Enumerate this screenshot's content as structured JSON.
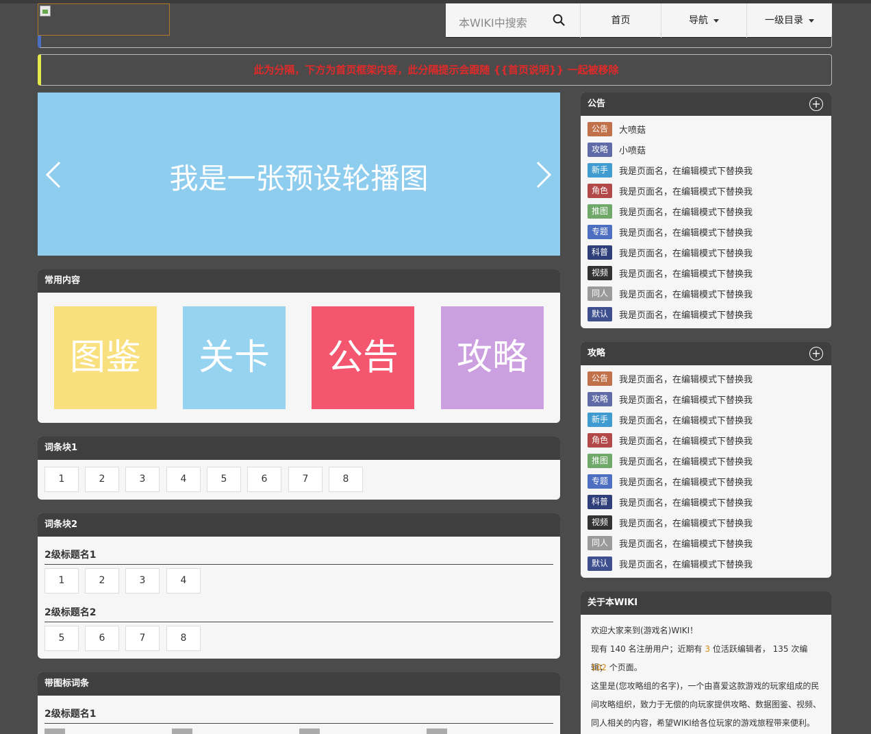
{
  "nav": {
    "search_text": "本WIKI中搜索",
    "home": "首页",
    "navigation": "导航",
    "level1": "一级目录"
  },
  "notice": "此为分隔，下方为首页框架内容，此分隔提示会跟随 {{首页说明}} 一起被移除",
  "carousel": {
    "text": "我是一张预设轮播图"
  },
  "common": {
    "title": "常用内容",
    "tiles": [
      {
        "label": "图鉴",
        "color": "#f9e07f"
      },
      {
        "label": "关卡",
        "color": "#96d3f1"
      },
      {
        "label": "公告",
        "color": "#f4566f"
      },
      {
        "label": "攻略",
        "color": "#cc9fe0"
      }
    ]
  },
  "block1": {
    "title": "词条块1",
    "items": [
      "1",
      "2",
      "3",
      "4",
      "5",
      "6",
      "7",
      "8"
    ]
  },
  "block2": {
    "title": "词条块2",
    "sections": [
      {
        "heading": "2级标题名1",
        "items": [
          "1",
          "2",
          "3",
          "4"
        ]
      },
      {
        "heading": "2级标题名2",
        "items": [
          "5",
          "6",
          "7",
          "8"
        ]
      }
    ]
  },
  "icon_block": {
    "title": "带图标词条",
    "heading": "2级标题名1"
  },
  "announcements": {
    "title": "公告",
    "plus": "+",
    "rows": [
      {
        "tag": "公告",
        "color": "#c0714a",
        "text": "大喷菇"
      },
      {
        "tag": "攻略",
        "color": "#5f6aa8",
        "text": "小喷菇"
      },
      {
        "tag": "新手",
        "color": "#3f9bd0",
        "text": "我是页面名，在编辑模式下替换我"
      },
      {
        "tag": "角色",
        "color": "#b34848",
        "text": "我是页面名，在编辑模式下替换我"
      },
      {
        "tag": "推图",
        "color": "#6fa869",
        "text": "我是页面名，在编辑模式下替换我"
      },
      {
        "tag": "专题",
        "color": "#4d6fc2",
        "text": "我是页面名，在编辑模式下替换我"
      },
      {
        "tag": "科普",
        "color": "#2f3f7a",
        "text": "我是页面名，在编辑模式下替换我"
      },
      {
        "tag": "视频",
        "color": "#333333",
        "text": "我是页面名，在编辑模式下替换我"
      },
      {
        "tag": "同人",
        "color": "#9a9a9a",
        "text": "我是页面名，在编辑模式下替换我"
      },
      {
        "tag": "默认",
        "color": "#3d4f8f",
        "text": "我是页面名，在编辑模式下替换我"
      }
    ]
  },
  "guides": {
    "title": "攻略",
    "plus": "+",
    "rows": [
      {
        "tag": "公告",
        "color": "#c0714a",
        "text": "我是页面名，在编辑模式下替换我"
      },
      {
        "tag": "攻略",
        "color": "#5f6aa8",
        "text": "我是页面名，在编辑模式下替换我"
      },
      {
        "tag": "新手",
        "color": "#3f9bd0",
        "text": "我是页面名，在编辑模式下替换我"
      },
      {
        "tag": "角色",
        "color": "#b34848",
        "text": "我是页面名，在编辑模式下替换我"
      },
      {
        "tag": "推图",
        "color": "#6fa869",
        "text": "我是页面名，在编辑模式下替换我"
      },
      {
        "tag": "专题",
        "color": "#4d6fc2",
        "text": "我是页面名，在编辑模式下替换我"
      },
      {
        "tag": "科普",
        "color": "#2f3f7a",
        "text": "我是页面名，在编辑模式下替换我"
      },
      {
        "tag": "视频",
        "color": "#333333",
        "text": "我是页面名，在编辑模式下替换我"
      },
      {
        "tag": "同人",
        "color": "#9a9a9a",
        "text": "我是页面名，在编辑模式下替换我"
      },
      {
        "tag": "默认",
        "color": "#3d4f8f",
        "text": "我是页面名，在编辑模式下替换我"
      }
    ]
  },
  "about": {
    "title": "关于本WIKI",
    "welcome": "欢迎大家来到(游戏名)WIKI！",
    "stats_prefix": "现有 140 名注册用户；近期有 ",
    "active": "3",
    "stats_mid": " 位活跃编辑者， 135 次编辑；",
    "pages_num": "102",
    "pages_suffix": " 个页面。",
    "desc1": "这里是(您攻略组的名字)，一个由喜爱这款游戏的玩家组成的民",
    "desc2": "间攻略组织，致力于无偿的向玩家提供攻略、数据图鉴、视频、",
    "desc3": "同人相关的内容，希望WIKI给各位玩家的游戏旅程带来便利。"
  }
}
